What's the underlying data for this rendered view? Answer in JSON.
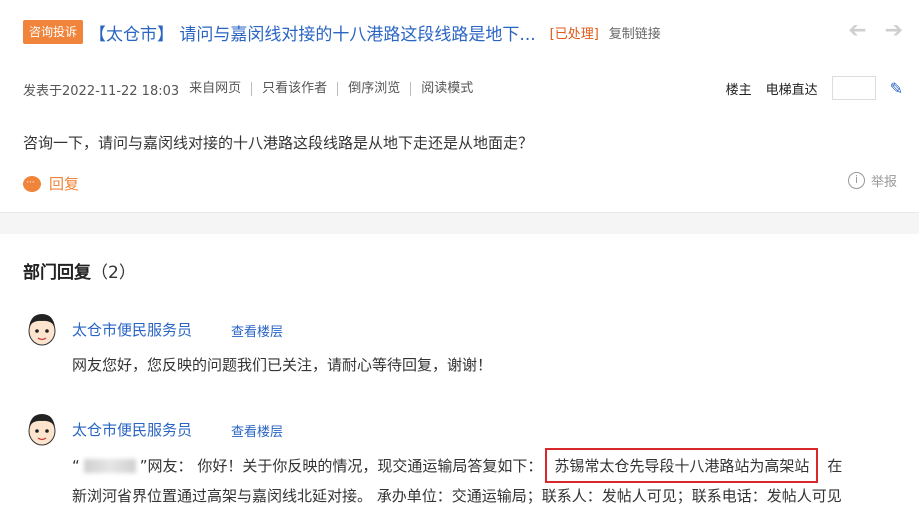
{
  "header": {
    "badge": "咨询投诉",
    "title": "【太仓市】 请问与嘉闵线对接的十八港路这段线路是地下...",
    "status": "[已处理]",
    "copy_link": "复制链接"
  },
  "meta": {
    "posted": "发表于2022-11-22 18:03",
    "source": "来自网页",
    "author_only": "只看该作者",
    "reverse": "倒序浏览",
    "read_mode": "阅读模式",
    "floor_owner": "楼主",
    "elevator": "电梯直达"
  },
  "post": {
    "body": "咨询一下，请问与嘉闵线对接的十八港路这段线路是从地下走还是从地面走？",
    "reply": "回复",
    "report": "举报"
  },
  "replies_section": {
    "title": "部门回复",
    "count": "（2）",
    "items": [
      {
        "name": "太仓市便民服务员",
        "view_floor": "查看楼层",
        "text": "网友您好，您反映的问题我们已关注，请耐心等待回复，谢谢！"
      },
      {
        "name": "太仓市便民服务员",
        "view_floor": "查看楼层",
        "line1_prefix_open": "“",
        "line1_prefix_close": "”网友： 你好！关于你反映的情况，现交通运输局答复如下：",
        "highlight": "苏锡常太仓先导段十八港路站为高架站",
        "line1_suffix": "在",
        "line2": "新浏河省界位置通过高架与嘉闵线北延对接。 承办单位：交通运输局；联系人：发帖人可见；联系电话：发帖人可见"
      }
    ]
  },
  "colors": {
    "accent": "#f0843a",
    "link": "#2a65c4",
    "status": "#e05a1a",
    "highlight_border": "#d8282b"
  }
}
